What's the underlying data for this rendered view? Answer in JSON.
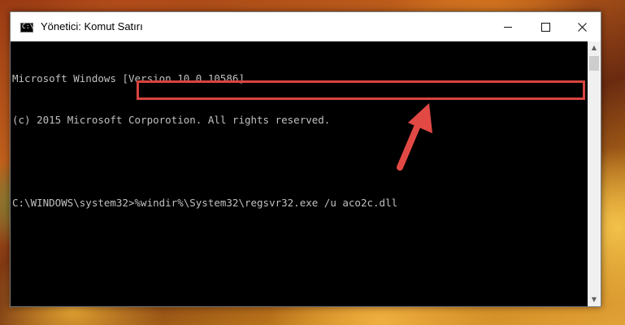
{
  "window": {
    "title": "Yönetici: Komut Satırı",
    "icon": "cmd-icon",
    "controls": {
      "minimize": "minimize-icon",
      "maximize": "maximize-icon",
      "close": "close-icon"
    }
  },
  "console": {
    "lines": [
      "Microsoft Windows [Version 10.0.10586]",
      "(c) 2015 Microsoft Corporotion. All rights reserved.",
      "",
      "C:\\WINDOWS\\system32>%windir%\\System32\\regsvr32.exe /u aco2c.dll"
    ],
    "text_color": "#c0c0c0",
    "background": "#000000"
  },
  "annotation": {
    "highlight_color": "#d9443f",
    "arrow_color": "#e24a44"
  }
}
